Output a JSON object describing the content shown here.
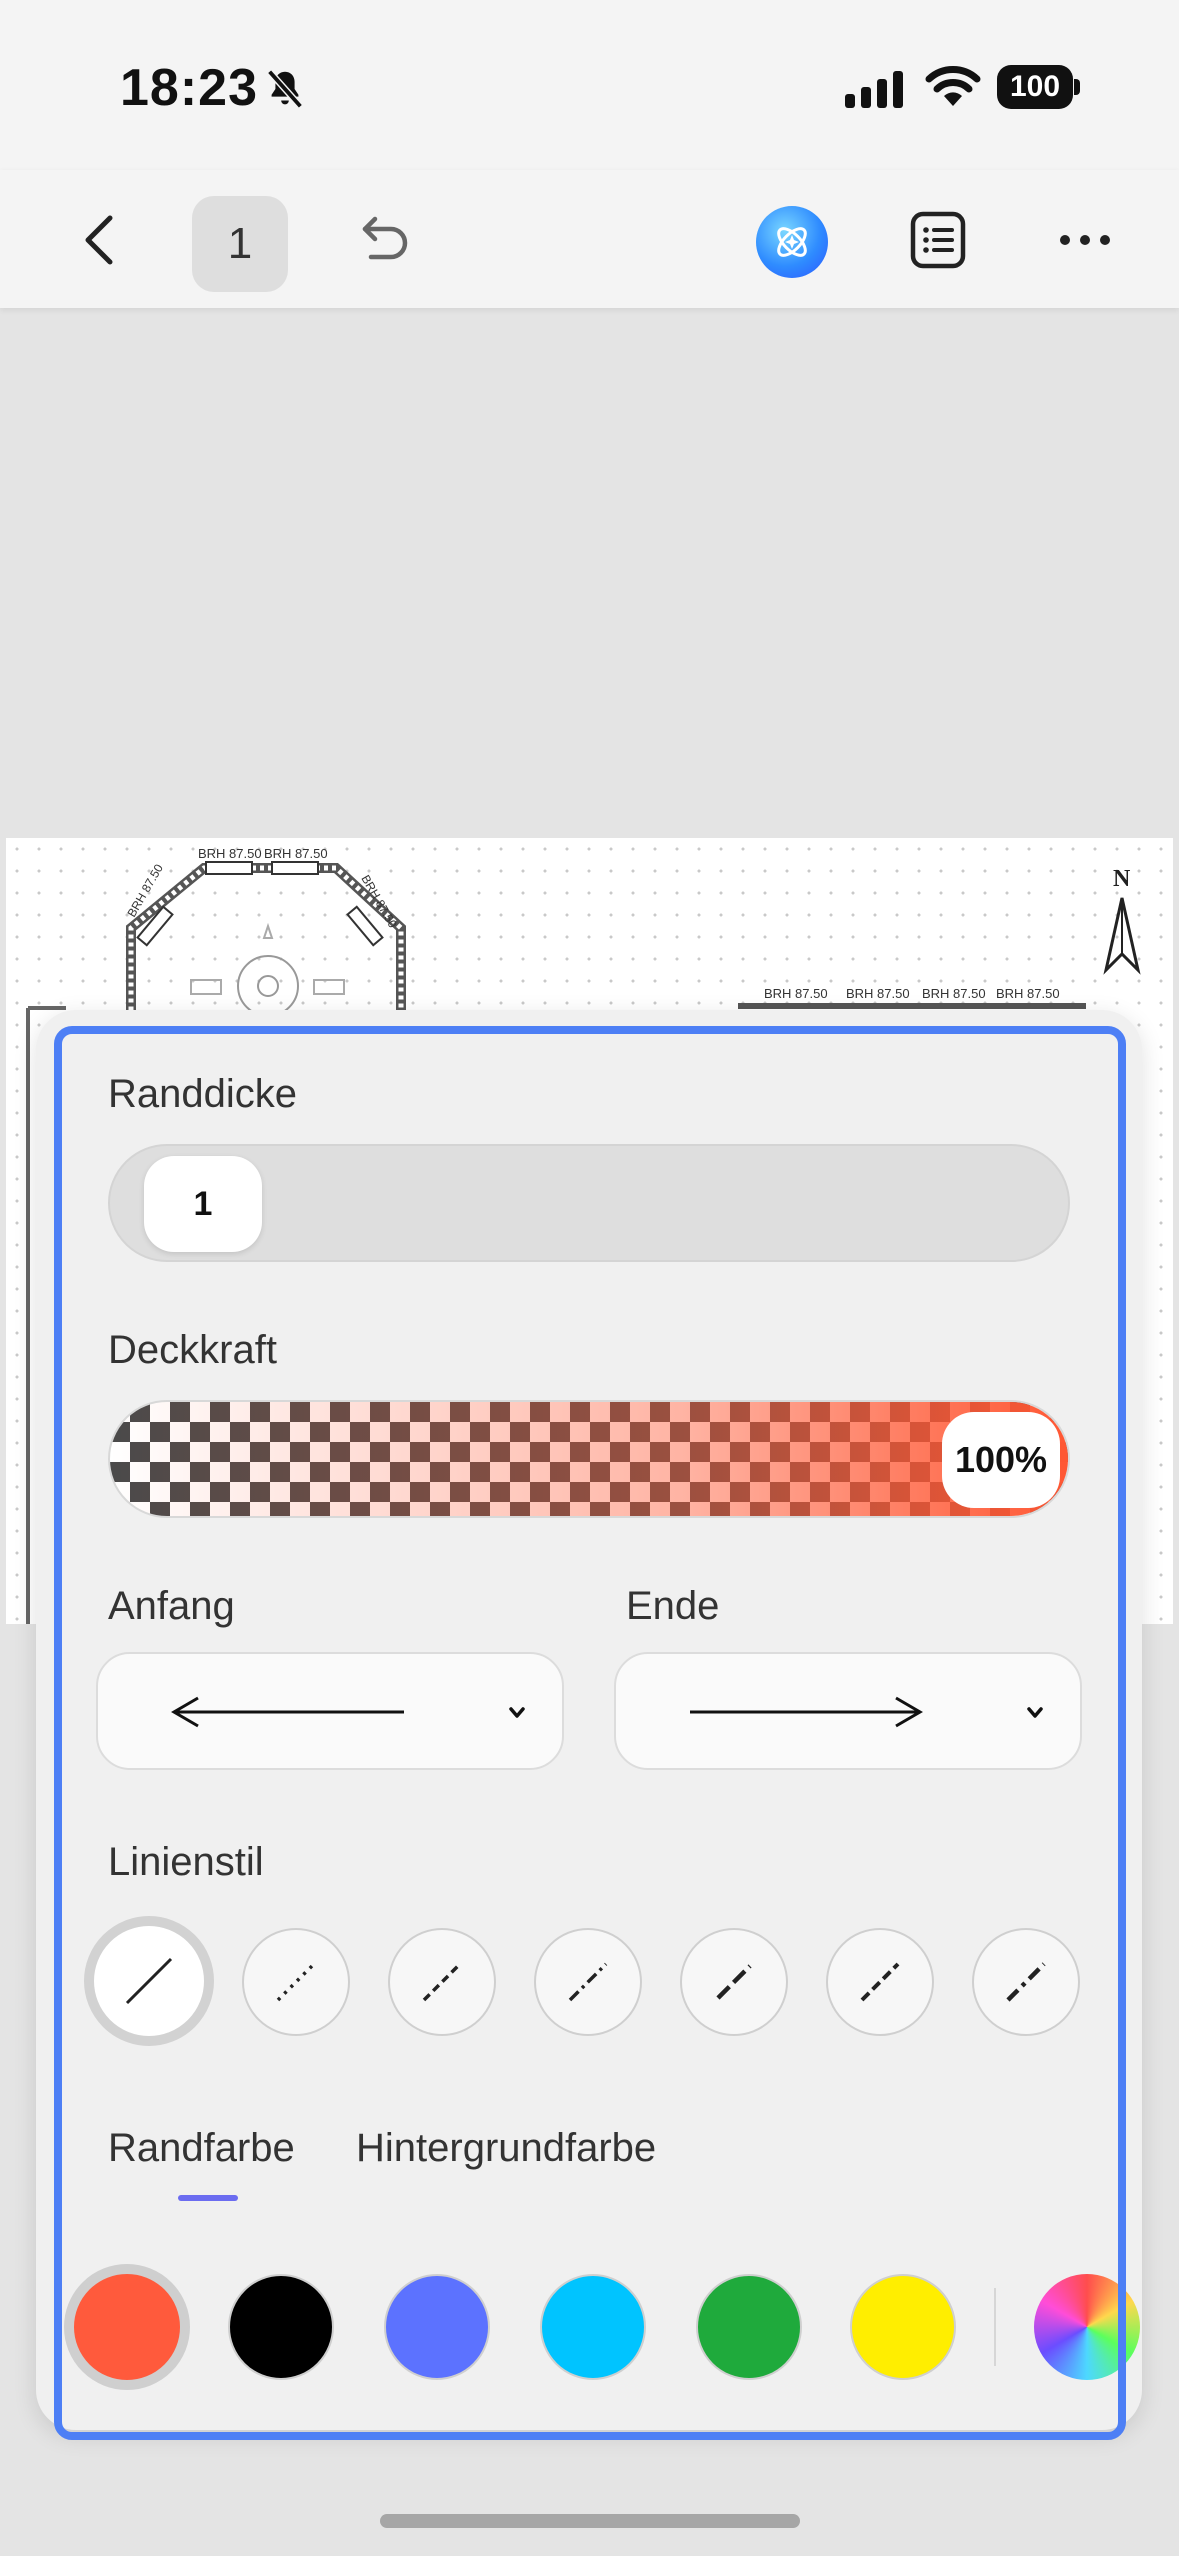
{
  "status_bar": {
    "time": "18:23",
    "battery": "100",
    "icons": [
      "bell-slash-icon",
      "cellular-signal-icon",
      "wifi-icon",
      "battery-icon"
    ]
  },
  "toolbar": {
    "page_number": "1",
    "icons": [
      "chevron-left-icon",
      "undo-icon",
      "ai-assistant-icon",
      "list-icon",
      "more-icon"
    ]
  },
  "document": {
    "labels": [
      "BRH 87.50",
      "BRH 87.50",
      "BRH 87.50",
      "BRH 87.50",
      "BRH 87.50'",
      "BRH 87.50",
      "BRH 87.50",
      "BRH 87.50",
      "BRH 87.50"
    ],
    "north_label": "N"
  },
  "panel": {
    "border_width_label": "Randdicke",
    "border_width_value": "1",
    "opacity_label": "Deckkraft",
    "opacity_value": "100%",
    "opacity_fraction": 1.0,
    "start_label": "Anfang",
    "end_label": "Ende",
    "start_value_icon": "arrow-left-line-icon",
    "end_value_icon": "arrow-right-line-icon",
    "line_style_label": "Linienstil",
    "line_styles": [
      "solid",
      "dotted",
      "short-dash",
      "dash-dot",
      "long-dash",
      "dash",
      "dash-long-gap"
    ],
    "selected_line_style": 0,
    "tabs": [
      "Randfarbe",
      "Hintergrundfarbe"
    ],
    "active_tab": 0,
    "colors": [
      "#ff5a3c",
      "#000000",
      "#5c72ff",
      "#00c4ff",
      "#1faa3c",
      "#ffee00"
    ],
    "selected_color": 0,
    "accent": "#4d7ff5"
  }
}
